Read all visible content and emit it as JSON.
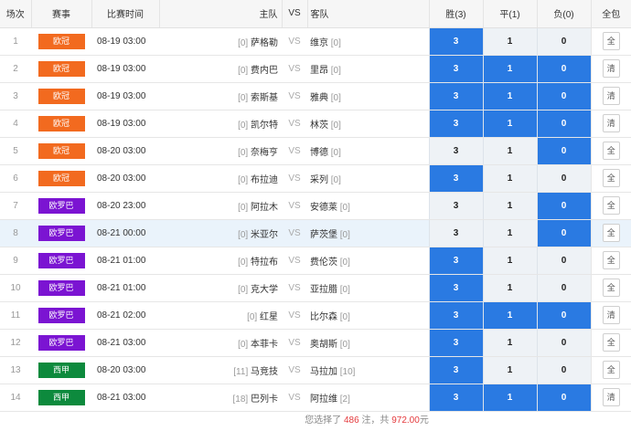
{
  "headers": {
    "idx": "场次",
    "league": "赛事",
    "time": "比赛时间",
    "home": "主队",
    "vs": "VS",
    "away": "客队",
    "win": "胜(3)",
    "draw": "平(1)",
    "lose": "负(0)",
    "all": "全包"
  },
  "colors": {
    "ucl": "#f26a1f",
    "uel": "#7b14d2",
    "laliga": "#0d8a3d",
    "selected": "#2a7ae2"
  },
  "rows": [
    {
      "idx": "1",
      "league": "欧冠",
      "league_type": "ucl",
      "time": "08-19 03:00",
      "home_rank": "[0]",
      "home": "萨格勒",
      "vs": "VS",
      "away": "维京",
      "away_rank": "[0]",
      "win": "3",
      "draw": "1",
      "lose": "0",
      "win_sel": true,
      "draw_sel": false,
      "lose_sel": false,
      "all": "全"
    },
    {
      "idx": "2",
      "league": "欧冠",
      "league_type": "ucl",
      "time": "08-19 03:00",
      "home_rank": "[0]",
      "home": "费内巴",
      "vs": "VS",
      "away": "里昂",
      "away_rank": "[0]",
      "win": "3",
      "draw": "1",
      "lose": "0",
      "win_sel": true,
      "draw_sel": true,
      "lose_sel": true,
      "all": "清"
    },
    {
      "idx": "3",
      "league": "欧冠",
      "league_type": "ucl",
      "time": "08-19 03:00",
      "home_rank": "[0]",
      "home": "索斯基",
      "vs": "VS",
      "away": "雅典",
      "away_rank": "[0]",
      "win": "3",
      "draw": "1",
      "lose": "0",
      "win_sel": true,
      "draw_sel": true,
      "lose_sel": true,
      "all": "清"
    },
    {
      "idx": "4",
      "league": "欧冠",
      "league_type": "ucl",
      "time": "08-19 03:00",
      "home_rank": "[0]",
      "home": "凯尔特",
      "vs": "VS",
      "away": "林茨",
      "away_rank": "[0]",
      "win": "3",
      "draw": "1",
      "lose": "0",
      "win_sel": true,
      "draw_sel": true,
      "lose_sel": true,
      "all": "清"
    },
    {
      "idx": "5",
      "league": "欧冠",
      "league_type": "ucl",
      "time": "08-20 03:00",
      "home_rank": "[0]",
      "home": "奈梅亨",
      "vs": "VS",
      "away": "博德",
      "away_rank": "[0]",
      "win": "3",
      "draw": "1",
      "lose": "0",
      "win_sel": false,
      "draw_sel": false,
      "lose_sel": true,
      "all": "全"
    },
    {
      "idx": "6",
      "league": "欧冠",
      "league_type": "ucl",
      "time": "08-20 03:00",
      "home_rank": "[0]",
      "home": "布拉迪",
      "vs": "VS",
      "away": "采列",
      "away_rank": "[0]",
      "win": "3",
      "draw": "1",
      "lose": "0",
      "win_sel": true,
      "draw_sel": false,
      "lose_sel": false,
      "all": "全"
    },
    {
      "idx": "7",
      "league": "欧罗巴",
      "league_type": "uel",
      "time": "08-20 23:00",
      "home_rank": "[0]",
      "home": "阿拉木",
      "vs": "VS",
      "away": "安德莱",
      "away_rank": "[0]",
      "win": "3",
      "draw": "1",
      "lose": "0",
      "win_sel": false,
      "draw_sel": false,
      "lose_sel": true,
      "all": "全"
    },
    {
      "idx": "8",
      "league": "欧罗巴",
      "league_type": "uel",
      "time": "08-21 00:00",
      "home_rank": "[0]",
      "home": "米亚尔",
      "vs": "VS",
      "away": "萨茨堡",
      "away_rank": "[0]",
      "win": "3",
      "draw": "1",
      "lose": "0",
      "win_sel": false,
      "draw_sel": false,
      "lose_sel": true,
      "all": "全",
      "highlight": true
    },
    {
      "idx": "9",
      "league": "欧罗巴",
      "league_type": "uel",
      "time": "08-21 01:00",
      "home_rank": "[0]",
      "home": "特拉布",
      "vs": "VS",
      "away": "费伦茨",
      "away_rank": "[0]",
      "win": "3",
      "draw": "1",
      "lose": "0",
      "win_sel": true,
      "draw_sel": false,
      "lose_sel": false,
      "all": "全"
    },
    {
      "idx": "10",
      "league": "欧罗巴",
      "league_type": "uel",
      "time": "08-21 01:00",
      "home_rank": "[0]",
      "home": "克大学",
      "vs": "VS",
      "away": "亚拉腊",
      "away_rank": "[0]",
      "win": "3",
      "draw": "1",
      "lose": "0",
      "win_sel": true,
      "draw_sel": false,
      "lose_sel": false,
      "all": "全"
    },
    {
      "idx": "11",
      "league": "欧罗巴",
      "league_type": "uel",
      "time": "08-21 02:00",
      "home_rank": "[0]",
      "home": "红星",
      "vs": "VS",
      "away": "比尔森",
      "away_rank": "[0]",
      "win": "3",
      "draw": "1",
      "lose": "0",
      "win_sel": true,
      "draw_sel": true,
      "lose_sel": true,
      "all": "清"
    },
    {
      "idx": "12",
      "league": "欧罗巴",
      "league_type": "uel",
      "time": "08-21 03:00",
      "home_rank": "[0]",
      "home": "本菲卡",
      "vs": "VS",
      "away": "奥胡斯",
      "away_rank": "[0]",
      "win": "3",
      "draw": "1",
      "lose": "0",
      "win_sel": true,
      "draw_sel": false,
      "lose_sel": false,
      "all": "全"
    },
    {
      "idx": "13",
      "league": "西甲",
      "league_type": "laliga",
      "time": "08-20 03:00",
      "home_rank": "[11]",
      "home": "马竞技",
      "vs": "VS",
      "away": "马拉加",
      "away_rank": "[10]",
      "win": "3",
      "draw": "1",
      "lose": "0",
      "win_sel": true,
      "draw_sel": false,
      "lose_sel": false,
      "all": "全"
    },
    {
      "idx": "14",
      "league": "西甲",
      "league_type": "laliga",
      "time": "08-21 03:00",
      "home_rank": "[18]",
      "home": "巴列卡",
      "vs": "VS",
      "away": "阿拉维",
      "away_rank": "[2]",
      "win": "3",
      "draw": "1",
      "lose": "0",
      "win_sel": true,
      "draw_sel": true,
      "lose_sel": true,
      "all": "清"
    }
  ],
  "footer": {
    "prefix": "您选择了",
    "count": "486",
    "mid": "注，共",
    "amount": "972.00",
    "suffix": "元"
  }
}
